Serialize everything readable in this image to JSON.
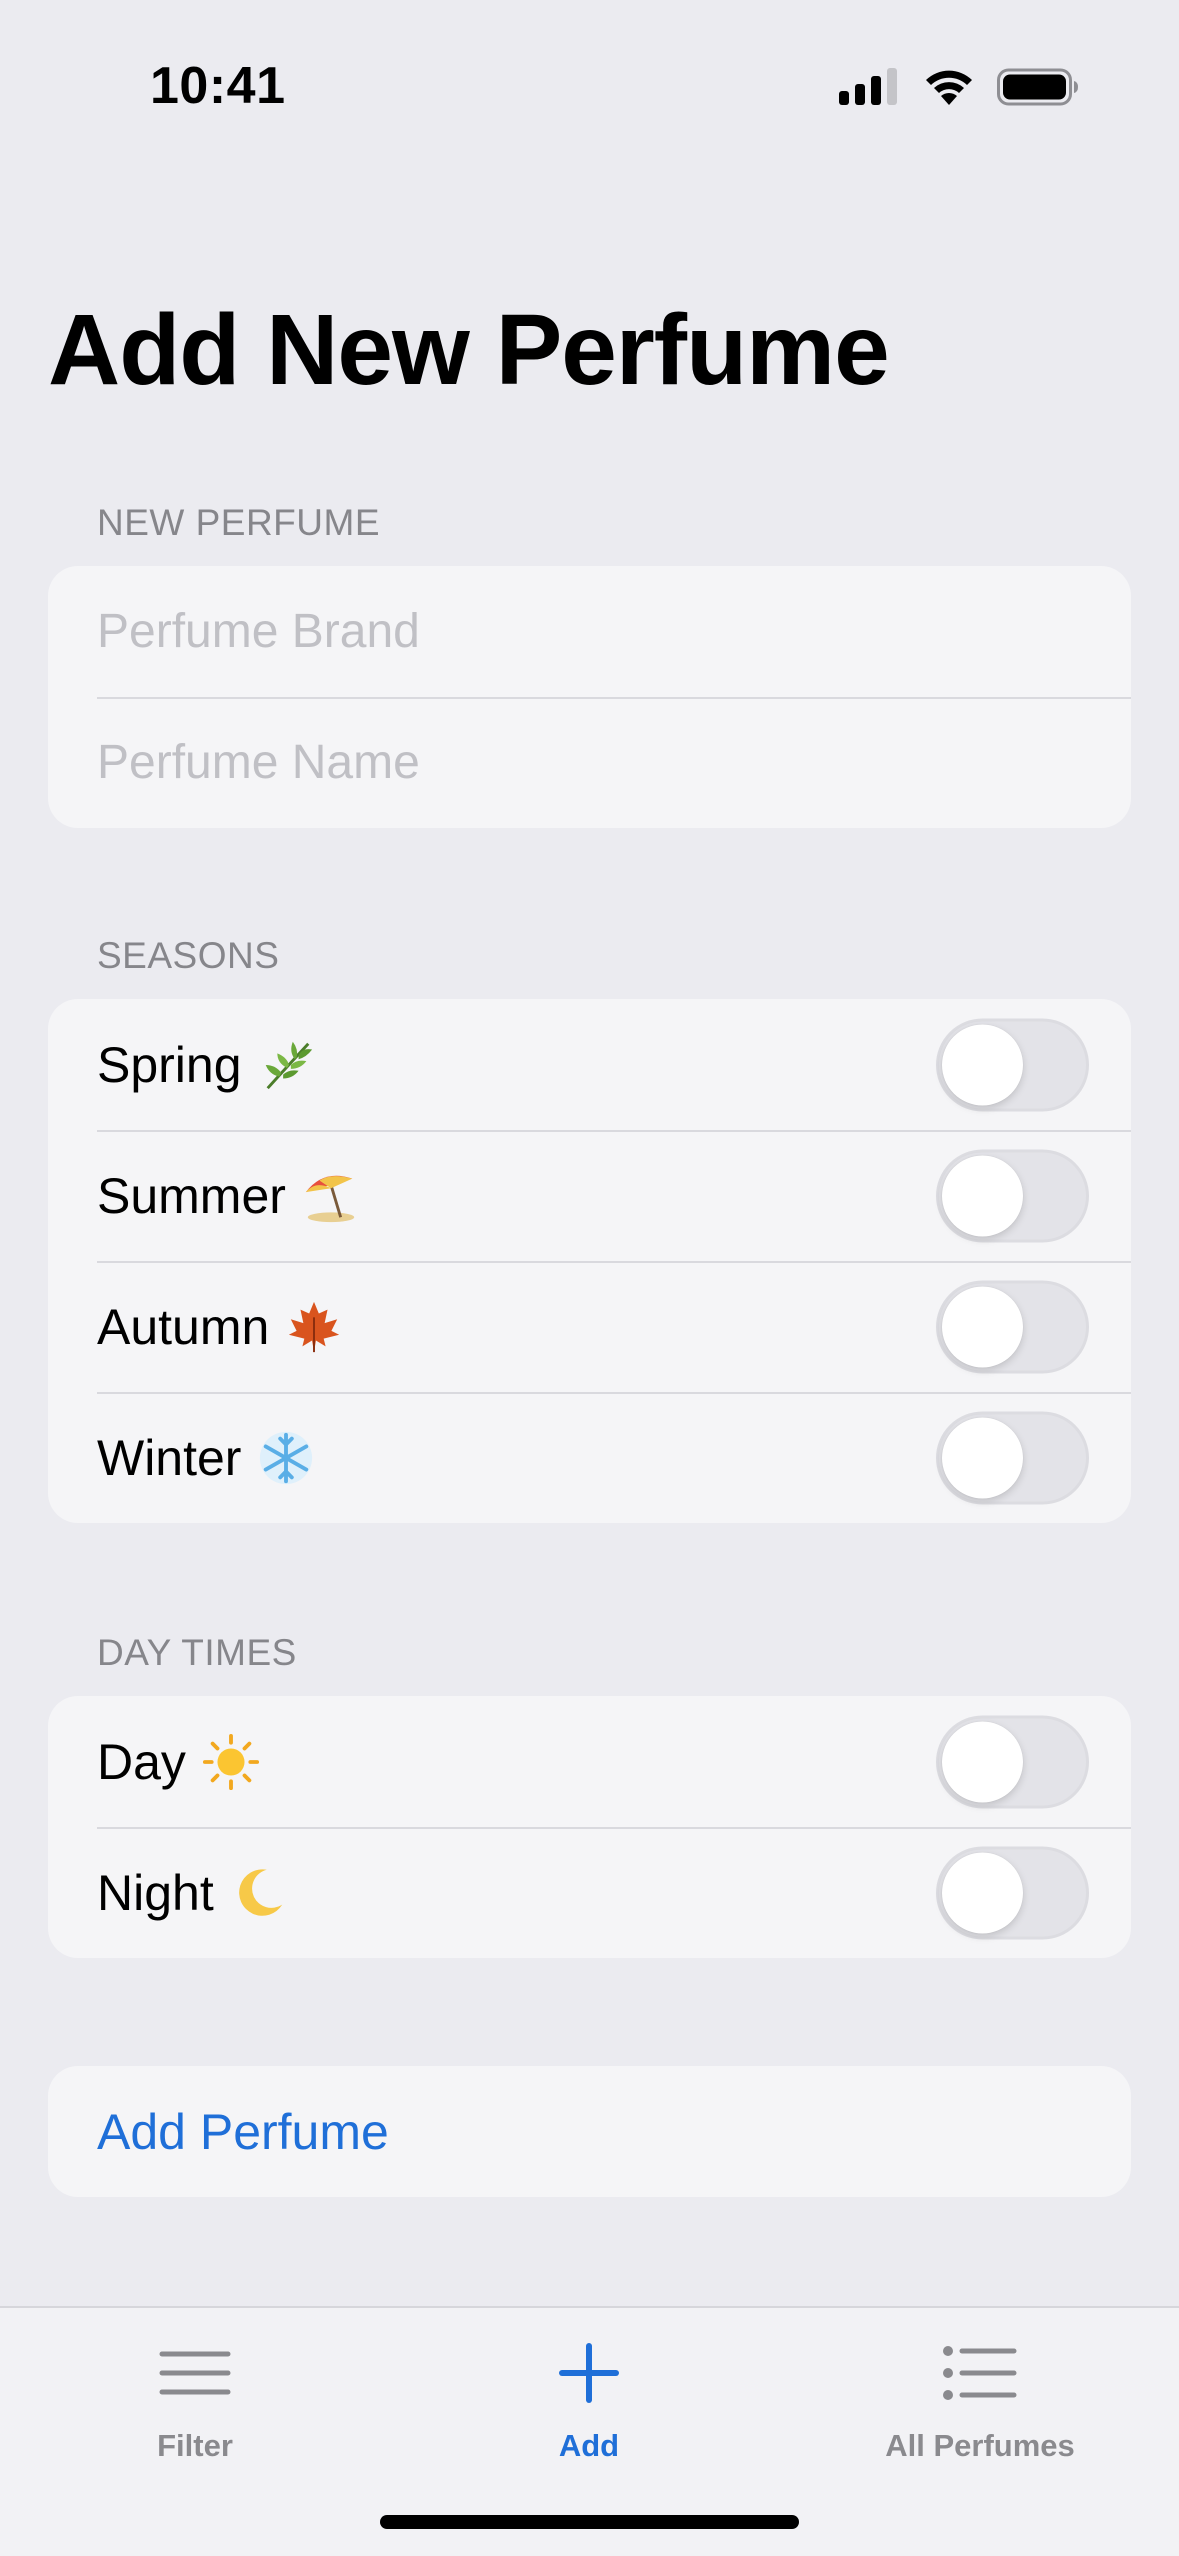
{
  "status_bar": {
    "time": "10:41"
  },
  "page": {
    "title": "Add New Perfume"
  },
  "new_perfume": {
    "header": "NEW PERFUME",
    "brand_placeholder": "Perfume Brand",
    "name_placeholder": "Perfume Name",
    "brand_value": "",
    "name_value": ""
  },
  "seasons": {
    "header": "SEASONS",
    "items": [
      {
        "label": "Spring",
        "emoji": "herb-icon",
        "on": false
      },
      {
        "label": "Summer",
        "emoji": "beach-umbrella-icon",
        "on": false
      },
      {
        "label": "Autumn",
        "emoji": "maple-leaf-icon",
        "on": false
      },
      {
        "label": "Winter",
        "emoji": "snowflake-icon",
        "on": false
      }
    ]
  },
  "day_times": {
    "header": "DAY TIMES",
    "items": [
      {
        "label": "Day",
        "emoji": "sun-icon",
        "on": false
      },
      {
        "label": "Night",
        "emoji": "crescent-moon-icon",
        "on": false
      }
    ]
  },
  "actions": {
    "add_perfume_label": "Add Perfume"
  },
  "tab_bar": {
    "tabs": [
      {
        "label": "Filter",
        "icon": "filter-lines-icon",
        "active": false
      },
      {
        "label": "Add",
        "icon": "plus-icon",
        "active": true
      },
      {
        "label": "All Perfumes",
        "icon": "list-icon",
        "active": false
      }
    ]
  },
  "colors": {
    "accent": "#1f6fd8",
    "background": "#ebebf0",
    "card": "#f5f5f7",
    "secondary_text": "#86868b"
  }
}
